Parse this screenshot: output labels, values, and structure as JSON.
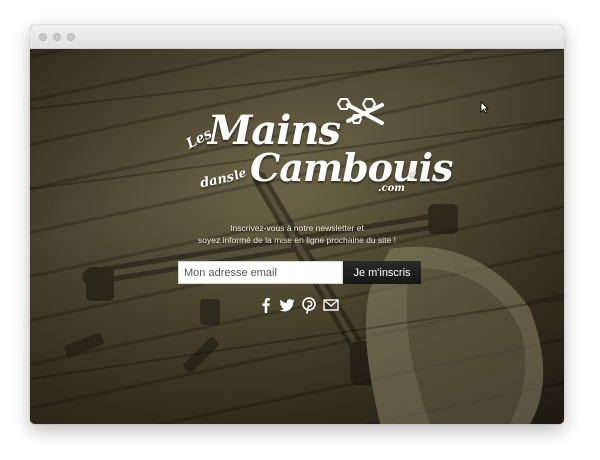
{
  "browser": {
    "window_controls": [
      "close",
      "minimize",
      "maximize"
    ]
  },
  "logo": {
    "les": "Les",
    "mains": "Mains",
    "dans": "dans",
    "le": "le",
    "cambouis": "Cambouis",
    "com": ".com",
    "registered": "®"
  },
  "newsletter": {
    "tagline_line1": "Inscrivez-vous à notre newsletter et",
    "tagline_line2": "soyez informé de la mise en ligne prochaine du site !",
    "email_placeholder": "Mon adresse email",
    "email_value": "",
    "submit_label": "Je m'inscris"
  },
  "social": {
    "icons": [
      "facebook-icon",
      "twitter-icon",
      "pinterest-icon",
      "email-icon"
    ]
  },
  "colors": {
    "text": "#ffffff",
    "button": "#1c1c1c",
    "background_tint": "#5e5639"
  }
}
